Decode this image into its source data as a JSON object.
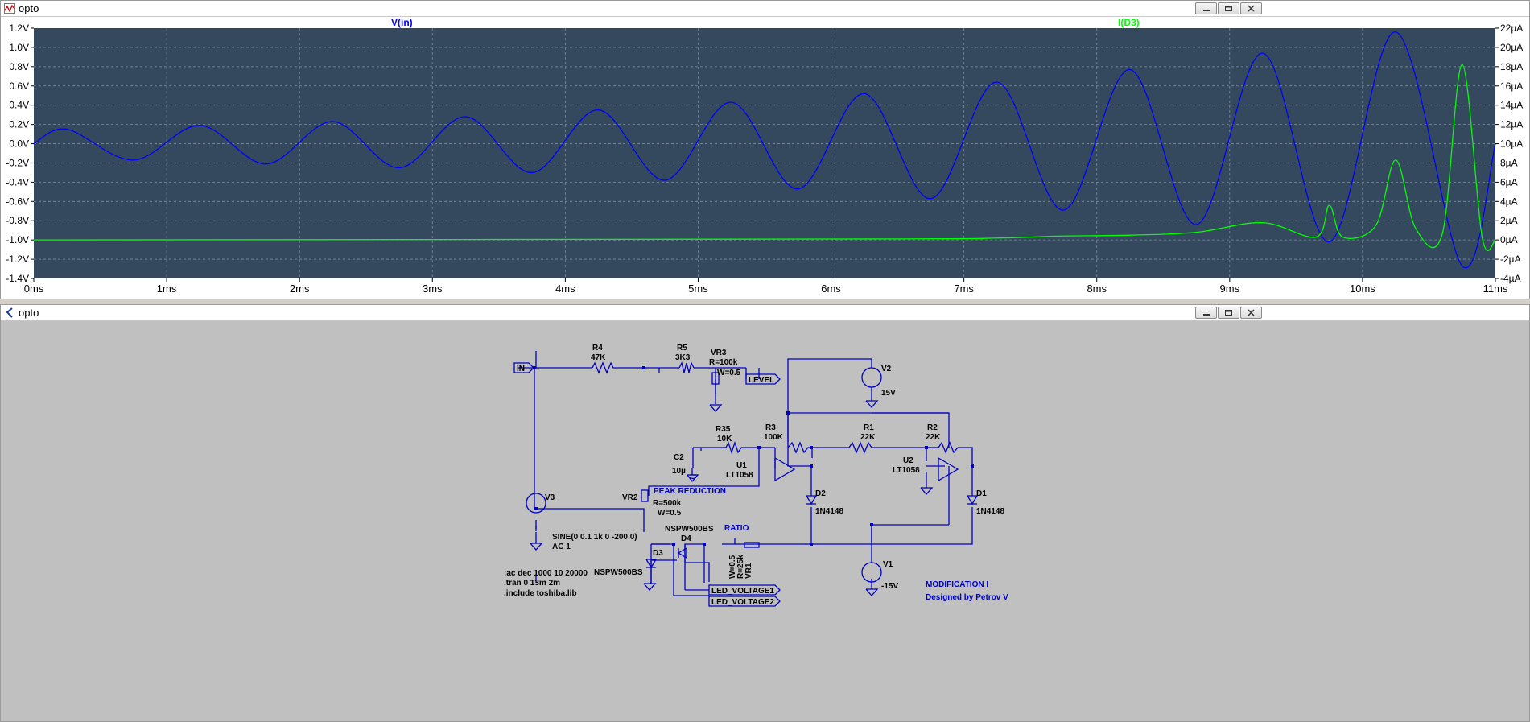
{
  "windows": {
    "waveform": {
      "title": "opto"
    },
    "schematic": {
      "title": "opto"
    }
  },
  "icons": {
    "waveform_app": "waveform-icon",
    "schematic_app": "schematic-icon",
    "minimize": "minimize-icon",
    "restore": "restore-icon",
    "close": "close-icon"
  },
  "colors": {
    "plot_bg": "#34495e",
    "vin": "#0000ff",
    "id3": "#00ff00",
    "grid": "#7f8fa0",
    "schematic_bg": "#c0c0c0",
    "wire": "#0000c0"
  },
  "chart_data": {
    "type": "line",
    "x_unit": "ms",
    "xlim": [
      0,
      11
    ],
    "x_ticks": [
      "0ms",
      "1ms",
      "2ms",
      "3ms",
      "4ms",
      "5ms",
      "6ms",
      "7ms",
      "8ms",
      "9ms",
      "10ms",
      "11ms"
    ],
    "y_left": {
      "ylim": [
        -1.4,
        1.2
      ],
      "ticks": [
        "1.2V",
        "1.0V",
        "0.8V",
        "0.6V",
        "0.4V",
        "0.2V",
        "0.0V",
        "-0.2V",
        "-0.4V",
        "-0.6V",
        "-0.8V",
        "-1.0V",
        "-1.2V",
        "-1.4V"
      ]
    },
    "y_right": {
      "ylim": [
        -4,
        22
      ],
      "ticks": [
        "22µA",
        "20µA",
        "18µA",
        "16µA",
        "14µA",
        "12µA",
        "10µA",
        "8µA",
        "6µA",
        "4µA",
        "2µA",
        "0µA",
        "-2µA",
        "-4µA"
      ]
    },
    "grid": true,
    "series": [
      {
        "name": "V(in)",
        "axis": "left",
        "color": "#0000ff",
        "x": [
          0,
          0.25,
          0.75,
          1.25,
          1.75,
          2.25,
          2.75,
          3.25,
          3.75,
          4.25,
          4.75,
          5.25,
          5.75,
          6.25,
          6.75,
          7.25,
          7.75,
          8.25,
          8.75,
          9.25,
          9.75,
          10.25,
          10.75,
          11.0
        ],
        "y": [
          0.0,
          0.15,
          -0.17,
          0.19,
          -0.21,
          0.23,
          -0.25,
          0.28,
          -0.3,
          0.35,
          -0.38,
          0.43,
          -0.47,
          0.52,
          -0.57,
          0.64,
          -0.69,
          0.77,
          -0.84,
          0.94,
          -1.02,
          1.16,
          -1.27,
          0.0
        ]
      },
      {
        "name": "I(D3)",
        "axis": "right",
        "color": "#00ff00",
        "x": [
          0,
          6.25,
          7.25,
          7.7,
          8.25,
          8.75,
          9.25,
          9.65,
          9.75,
          9.85,
          10.1,
          10.25,
          10.4,
          10.6,
          10.75,
          10.9,
          11.0
        ],
        "y": [
          0,
          0.1,
          0.2,
          0.4,
          0.5,
          0.8,
          1.8,
          0.3,
          3.6,
          0.3,
          1.5,
          8.3,
          1.2,
          0.6,
          18.2,
          0.3,
          0
        ]
      }
    ]
  },
  "schematic": {
    "labels": {
      "r4_name": "R4",
      "r4_value": "47K",
      "r5_name": "R5",
      "r5_value": "3K3",
      "vr3_name": "VR3",
      "vr3_r": "R=100k",
      "vr3_w": "W=0.5",
      "r35_name": "R35",
      "r35_value": "10K",
      "r3_name": "R3",
      "r3_value": "100K",
      "r1_name": "R1",
      "r1_value": "22K",
      "r2_name": "R2",
      "r2_value": "22K",
      "c2_name": "C2",
      "c2_value": "10µ",
      "u1_name": "U1",
      "u1_model": "LT1058",
      "u2_name": "U2",
      "u2_model": "LT1058",
      "v2_name": "V2",
      "v2_value": "15V",
      "v1_name": "V1",
      "v1_value": "-15V",
      "v3_name": "V3",
      "v3_value": "SINE(0 0.1 1k 0 -200 0)",
      "v3_ac": "AC 1",
      "vr2_name": "VR2",
      "vr2_r": "R=500k",
      "vr2_w": "W=0.5",
      "d1_name": "D1",
      "d1_model": "1N4148",
      "d2_name": "D2",
      "d2_model": "1N4148",
      "d3_name": "D3",
      "d4_name": "D4",
      "nspw_top": "NSPW500BS",
      "nspw_left": "NSPW500BS",
      "vr1_name": "VR1",
      "vr1_r": "R=25k",
      "vr1_w": "W=0.5",
      "in_port": "IN",
      "level_port": "LEVEL",
      "led1_port": "LED_VOLTAGE1",
      "led2_port": "LED_VOLTAGE2",
      "peak_reduction": "PEAK REDUCTION",
      "ratio": "RATIO",
      "directive1": ";ac dec 1000 10 20000",
      "directive2": ".tran 0 13m 2m",
      "directive3": ".include toshiba.lib",
      "modification": "MODIFICATION I",
      "designer": "Designed by Petrov V"
    }
  }
}
